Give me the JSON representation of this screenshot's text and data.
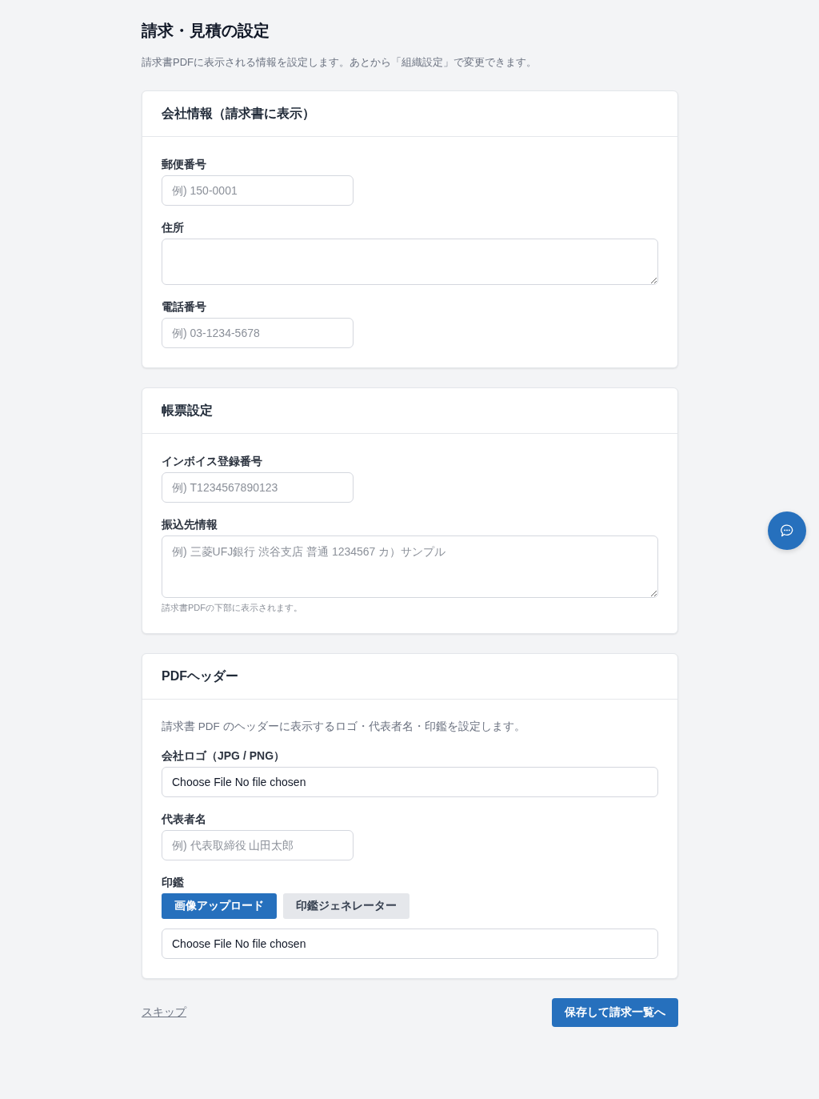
{
  "page": {
    "title": "請求・見積の設定",
    "description": "請求書PDFに表示される情報を設定します。あとから「組織設定」で変更できます。"
  },
  "sections": [
    {
      "title": "会社情報（請求書に表示）",
      "fields": [
        {
          "kind": "short",
          "label": "郵便番号",
          "placeholder": "例) 150-0001"
        },
        {
          "kind": "textarea",
          "label": "住所"
        },
        {
          "kind": "input",
          "label": "電話番号",
          "placeholder": "例) 03-1234-5678"
        }
      ]
    },
    {
      "title": "帳票設定",
      "fields": [
        {
          "kind": "input",
          "label": "インボイス登録番号",
          "placeholder": "例) T1234567890123"
        },
        {
          "kind": "longtext",
          "label": "振込先情報",
          "placeholder": "例) 三菱UFJ銀行 渋谷支店 普通 1234567 カ）サンプル",
          "hint": "請求書PDFの下部に表示されます。"
        }
      ]
    },
    {
      "title": "PDFヘッダー",
      "intro": "請求書 PDF のヘッダーに表示するロゴ・代表者名・印鑑を設定します。",
      "fields": [
        {
          "kind": "file",
          "label": "会社ロゴ（JPG / PNG）",
          "button": "Choose File",
          "status": "No file chosen"
        },
        {
          "kind": "input",
          "label": "代表者名",
          "placeholder": "例) 代表取締役 山田太郎"
        },
        {
          "kind": "stamp",
          "label": "印鑑",
          "options": [
            {
              "label": "画像アップロード",
              "selected": true
            },
            {
              "label": "印鑑ジェネレーター",
              "selected": false
            }
          ],
          "file": {
            "button": "Choose File",
            "status": "No file chosen"
          }
        }
      ]
    }
  ],
  "footer": {
    "skip": "スキップ",
    "save": "保存して請求一覧へ"
  }
}
